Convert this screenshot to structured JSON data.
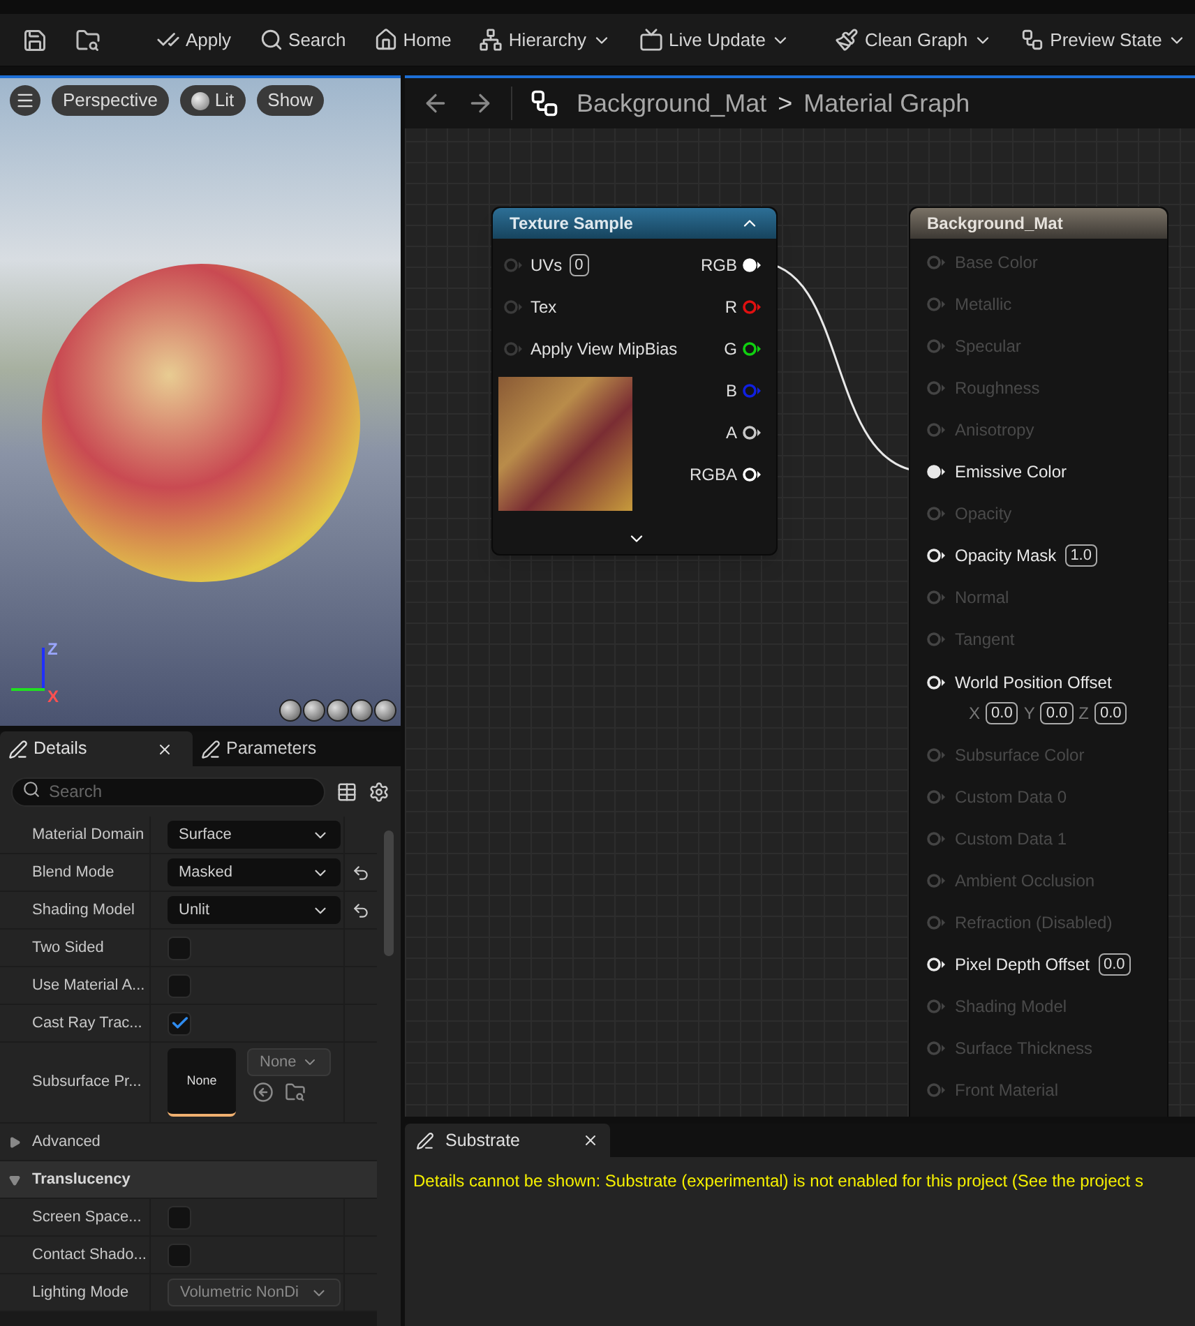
{
  "toolbar": {
    "items": [
      {
        "label": "Apply",
        "dropdown": false
      },
      {
        "label": "Search",
        "dropdown": false
      },
      {
        "label": "Home",
        "dropdown": false
      },
      {
        "label": "Hierarchy",
        "dropdown": true
      },
      {
        "label": "Live Update",
        "dropdown": true
      },
      {
        "label": "Clean Graph",
        "dropdown": true
      },
      {
        "label": "Preview State",
        "dropdown": true
      }
    ]
  },
  "viewport": {
    "buttons": [
      "Perspective",
      "Lit",
      "Show"
    ],
    "axis_labels": [
      "Z",
      "X"
    ]
  },
  "graph": {
    "breadcrumb": {
      "asset": "Background_Mat",
      "separator": ">",
      "graph": "Material Graph"
    },
    "texture_node": {
      "title": "Texture Sample",
      "inputs": [
        {
          "label": "UVs",
          "value": "0"
        },
        {
          "label": "Tex"
        },
        {
          "label": "Apply View MipBias"
        }
      ],
      "outputs": [
        {
          "label": "RGB",
          "color": "#ffffff",
          "connected": true
        },
        {
          "label": "R",
          "color": "#e01010",
          "connected": false
        },
        {
          "label": "G",
          "color": "#10d010",
          "connected": false
        },
        {
          "label": "B",
          "color": "#1020e0",
          "connected": false
        },
        {
          "label": "A",
          "color": "#c8c8c8",
          "connected": false
        },
        {
          "label": "RGBA",
          "color": "#ffffff",
          "connected": false
        }
      ]
    },
    "material_node": {
      "title": "Background_Mat",
      "pins": [
        {
          "label": "Base Color",
          "enabled": false,
          "connected": false
        },
        {
          "label": "Metallic",
          "enabled": false,
          "connected": false
        },
        {
          "label": "Specular",
          "enabled": false,
          "connected": false
        },
        {
          "label": "Roughness",
          "enabled": false,
          "connected": false
        },
        {
          "label": "Anisotropy",
          "enabled": false,
          "connected": false
        },
        {
          "label": "Emissive Color",
          "enabled": true,
          "connected": true
        },
        {
          "label": "Opacity",
          "enabled": false,
          "connected": false
        },
        {
          "label": "Opacity Mask",
          "enabled": true,
          "connected": false,
          "values": [
            {
              "value": "1.0"
            }
          ]
        },
        {
          "label": "Normal",
          "enabled": false,
          "connected": false
        },
        {
          "label": "Tangent",
          "enabled": false,
          "connected": false
        },
        {
          "label": "World Position Offset",
          "enabled": true,
          "connected": false,
          "values": [
            {
              "axis": "X",
              "value": "0.0"
            },
            {
              "axis": "Y",
              "value": "0.0"
            },
            {
              "axis": "Z",
              "value": "0.0"
            }
          ]
        },
        {
          "label": "Subsurface Color",
          "enabled": false,
          "connected": false
        },
        {
          "label": "Custom Data 0",
          "enabled": false,
          "connected": false
        },
        {
          "label": "Custom Data 1",
          "enabled": false,
          "connected": false
        },
        {
          "label": "Ambient Occlusion",
          "enabled": false,
          "connected": false
        },
        {
          "label": "Refraction (Disabled)",
          "enabled": false,
          "connected": false
        },
        {
          "label": "Pixel Depth Offset",
          "enabled": true,
          "connected": false,
          "values": [
            {
              "value": "0.0"
            }
          ]
        },
        {
          "label": "Shading Model",
          "enabled": false,
          "connected": false
        },
        {
          "label": "Surface Thickness",
          "enabled": false,
          "connected": false
        },
        {
          "label": "Front Material",
          "enabled": false,
          "connected": false
        }
      ]
    }
  },
  "details": {
    "tabs": [
      {
        "label": "Details",
        "selected": true,
        "closable": true
      },
      {
        "label": "Parameters",
        "selected": false,
        "closable": false
      }
    ],
    "search": {
      "placeholder": "Search"
    },
    "items": [
      {
        "kind": "dropdown",
        "label": "Material Domain",
        "value": "Surface",
        "disabled": false,
        "reset": false
      },
      {
        "kind": "dropdown",
        "label": "Blend Mode",
        "value": "Masked",
        "disabled": false,
        "reset": true
      },
      {
        "kind": "dropdown",
        "label": "Shading Model",
        "value": "Unlit",
        "disabled": false,
        "reset": true
      },
      {
        "kind": "checkbox",
        "label": "Two Sided",
        "checked": false
      },
      {
        "kind": "checkbox",
        "label": "Use Material A...",
        "checked": false
      },
      {
        "kind": "checkbox",
        "label": "Cast Ray Trac...",
        "checked": true
      },
      {
        "kind": "asset",
        "label": "Subsurface Pr...",
        "thumbnail": "None",
        "value": "None"
      },
      {
        "kind": "group",
        "label": "Advanced",
        "expanded": false
      },
      {
        "kind": "category",
        "label": "Translucency",
        "expanded": true
      },
      {
        "kind": "checkbox",
        "label": "Screen Space...",
        "checked": false
      },
      {
        "kind": "checkbox",
        "label": "Contact Shado...",
        "checked": false
      },
      {
        "kind": "dropdown",
        "label": "Lighting Mode",
        "value": "Volumetric NonDi",
        "disabled": true,
        "reset": false
      }
    ]
  },
  "substrate": {
    "tab": {
      "label": "Substrate"
    },
    "message": "Details cannot be shown: Substrate (experimental) is not enabled for this project (See the project s"
  }
}
